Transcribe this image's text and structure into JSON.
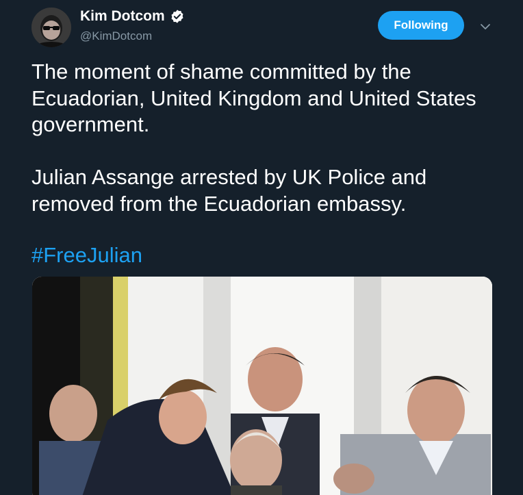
{
  "author": {
    "display_name": "Kim Dotcom",
    "handle": "@KimDotcom",
    "verified": true
  },
  "follow_button": {
    "label": "Following"
  },
  "tweet": {
    "paragraphs": [
      "The moment of shame committed by the Ecuadorian, United Kingdom and United States government.",
      "Julian Assange arrested by UK Police and removed from the Ecuadorian embassy."
    ],
    "hashtag": "#FreeJulian"
  },
  "colors": {
    "background": "#15202b",
    "accent": "#1da1f2",
    "secondary_text": "#8899a6",
    "primary_text": "#ffffff"
  },
  "icons": {
    "verified": "verified-badge-icon",
    "menu": "chevron-down-icon"
  }
}
